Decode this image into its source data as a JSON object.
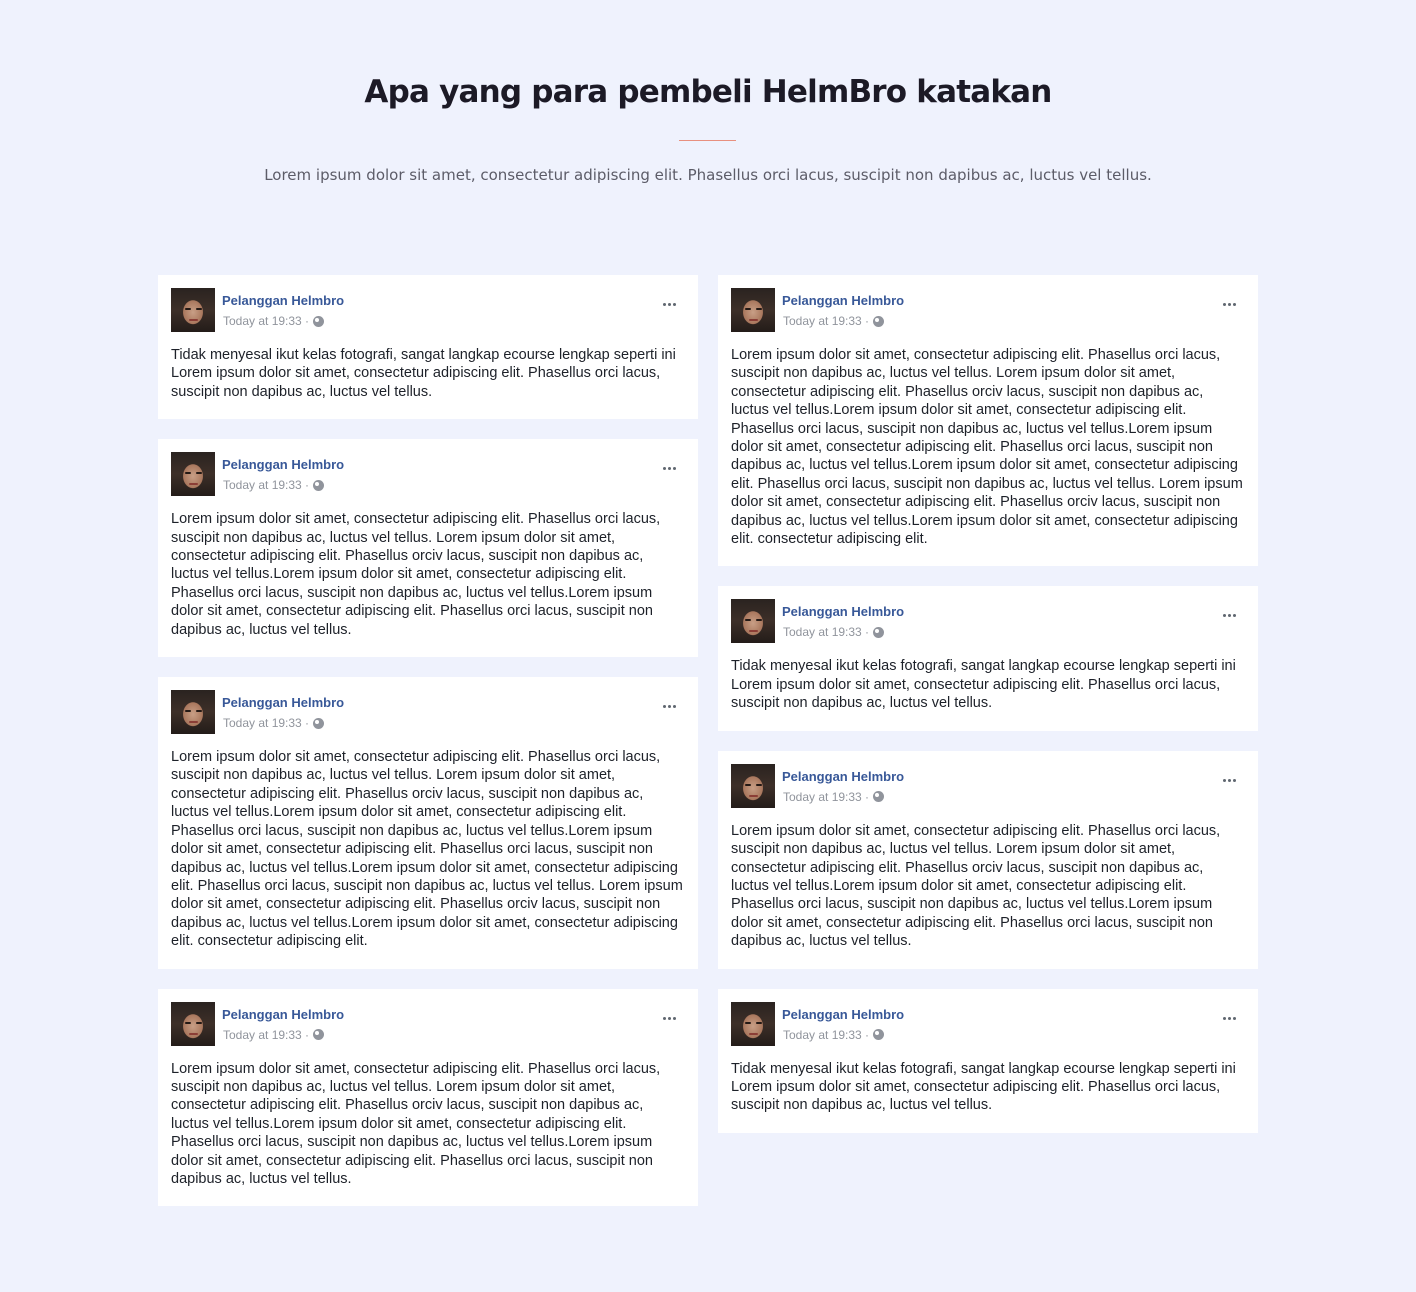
{
  "section": {
    "title": "Apa yang para pembeli HelmBro katakan",
    "subtitle": "Lorem ipsum dolor sit amet, consectetur adipiscing elit. Phasellus orci lacus, suscipit non dapibus ac, luctus vel tellus."
  },
  "icons": {
    "avatar": "profile-photo",
    "privacy": "globe-icon",
    "menu": "more-options-icon"
  },
  "colors": {
    "background": "#eff2fd",
    "author": "#385898",
    "divider": "#e8907f"
  },
  "left_column": [
    {
      "author": "Pelanggan Helmbro",
      "time": "Today at 19:33 ·",
      "text": "Tidak menyesal ikut kelas fotografi, sangat langkap ecourse lengkap seperti ini Lorem ipsum dolor sit amet, consectetur adipiscing elit. Phasellus orci lacus, suscipit non dapibus ac, luctus vel tellus."
    },
    {
      "author": "Pelanggan Helmbro",
      "time": "Today at 19:33 ·",
      "text": "Lorem ipsum dolor sit amet, consectetur adipiscing elit. Phasellus orci lacus, suscipit non dapibus ac, luctus vel tellus. Lorem ipsum dolor sit amet, consectetur adipiscing elit. Phasellus orciv lacus, suscipit non dapibus ac, luctus vel tellus.Lorem ipsum dolor sit amet, consectetur adipiscing elit. Phasellus orci lacus, suscipit non dapibus ac, luctus vel tellus.Lorem ipsum dolor sit amet, consectetur adipiscing elit. Phasellus orci lacus, suscipit non dapibus ac, luctus vel tellus."
    },
    {
      "author": "Pelanggan Helmbro",
      "time": "Today at 19:33 ·",
      "text": "Lorem ipsum dolor sit amet, consectetur adipiscing elit. Phasellus orci lacus, suscipit non dapibus ac, luctus vel tellus. Lorem ipsum dolor sit amet, consectetur adipiscing elit. Phasellus orciv lacus, suscipit non dapibus ac, luctus vel tellus.Lorem ipsum dolor sit amet, consectetur adipiscing elit. Phasellus orci lacus, suscipit non dapibus ac, luctus vel tellus.Lorem ipsum dolor sit amet, consectetur adipiscing elit. Phasellus orci lacus, suscipit non dapibus ac, luctus vel tellus.Lorem ipsum dolor sit amet, consectetur adipiscing elit. Phasellus orci lacus, suscipit non dapibus ac, luctus vel tellus. Lorem ipsum dolor sit amet, consectetur adipiscing elit. Phasellus orciv lacus, suscipit non dapibus ac, luctus vel tellus.Lorem ipsum dolor sit amet, consectetur adipiscing elit. consectetur adipiscing elit."
    },
    {
      "author": "Pelanggan Helmbro",
      "time": "Today at 19:33 ·",
      "text": "Lorem ipsum dolor sit amet, consectetur adipiscing elit. Phasellus orci lacus, suscipit non dapibus ac, luctus vel tellus. Lorem ipsum dolor sit amet, consectetur adipiscing elit. Phasellus orciv lacus, suscipit non dapibus ac, luctus vel tellus.Lorem ipsum dolor sit amet, consectetur adipiscing elit. Phasellus orci lacus, suscipit non dapibus ac, luctus vel tellus.Lorem ipsum dolor sit amet, consectetur adipiscing elit. Phasellus orci lacus, suscipit non dapibus ac, luctus vel tellus."
    }
  ],
  "right_column": [
    {
      "author": "Pelanggan Helmbro",
      "time": "Today at 19:33 ·",
      "text": "Lorem ipsum dolor sit amet, consectetur adipiscing elit. Phasellus orci lacus, suscipit non dapibus ac, luctus vel tellus. Lorem ipsum dolor sit amet, consectetur adipiscing elit. Phasellus orciv lacus, suscipit non dapibus ac, luctus vel tellus.Lorem ipsum dolor sit amet, consectetur adipiscing elit. Phasellus orci lacus, suscipit non dapibus ac, luctus vel tellus.Lorem ipsum dolor sit amet, consectetur adipiscing elit. Phasellus orci lacus, suscipit non dapibus ac, luctus vel tellus.Lorem ipsum dolor sit amet, consectetur adipiscing elit. Phasellus orci lacus, suscipit non dapibus ac, luctus vel tellus. Lorem ipsum dolor sit amet, consectetur adipiscing elit. Phasellus orciv lacus, suscipit non dapibus ac, luctus vel tellus.Lorem ipsum dolor sit amet, consectetur adipiscing elit. consectetur adipiscing elit."
    },
    {
      "author": "Pelanggan Helmbro",
      "time": "Today at 19:33 ·",
      "text": "Tidak menyesal ikut kelas fotografi, sangat langkap ecourse lengkap seperti ini Lorem ipsum dolor sit amet, consectetur adipiscing elit. Phasellus orci lacus, suscipit non dapibus ac, luctus vel tellus."
    },
    {
      "author": "Pelanggan Helmbro",
      "time": "Today at 19:33 ·",
      "text": "Lorem ipsum dolor sit amet, consectetur adipiscing elit. Phasellus orci lacus, suscipit non dapibus ac, luctus vel tellus. Lorem ipsum dolor sit amet, consectetur adipiscing elit. Phasellus orciv lacus, suscipit non dapibus ac, luctus vel tellus.Lorem ipsum dolor sit amet, consectetur adipiscing elit. Phasellus orci lacus, suscipit non dapibus ac, luctus vel tellus.Lorem ipsum dolor sit amet, consectetur adipiscing elit. Phasellus orci lacus, suscipit non dapibus ac, luctus vel tellus."
    },
    {
      "author": "Pelanggan Helmbro",
      "time": "Today at 19:33 ·",
      "text": "Tidak menyesal ikut kelas fotografi, sangat langkap ecourse lengkap seperti ini Lorem ipsum dolor sit amet, consectetur adipiscing elit. Phasellus orci lacus, suscipit non dapibus ac, luctus vel tellus."
    }
  ]
}
